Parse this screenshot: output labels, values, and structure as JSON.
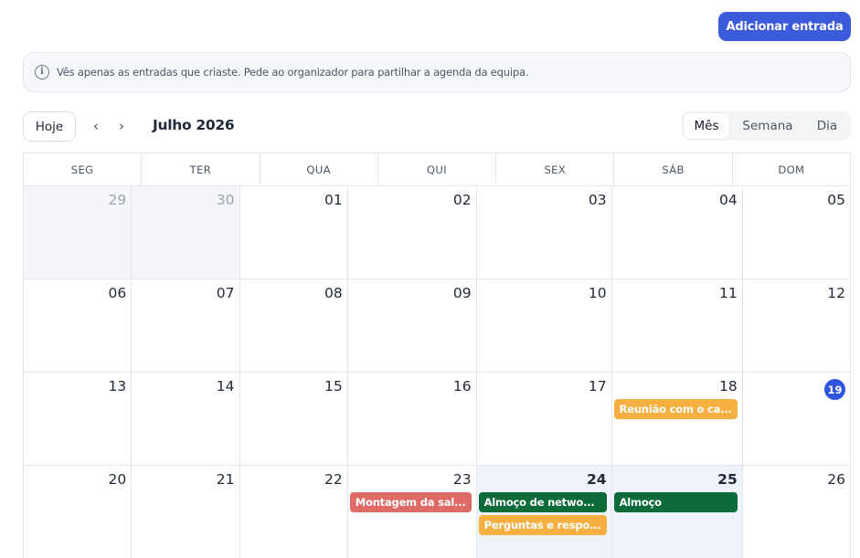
{
  "header": {
    "add_entry_label": "Adicionar entrada"
  },
  "info_banner": {
    "icon": "info-icon",
    "text": "Vês apenas as entradas que criaste. Pede ao organizador para partilhar a agenda da equipa."
  },
  "toolbar": {
    "today_label": "Hoje",
    "prev_icon": "chevron-left-icon",
    "next_icon": "chevron-right-icon",
    "prev_symbol": "‹",
    "next_symbol": "›",
    "month_label": "Julho 2026",
    "views": [
      {
        "label": "Mês",
        "active": true
      },
      {
        "label": "Semana",
        "active": false
      },
      {
        "label": "Dia",
        "active": false
      }
    ]
  },
  "calendar": {
    "weekdays": [
      "SEG",
      "TER",
      "QUA",
      "QUI",
      "SEX",
      "SÁB",
      "DOM"
    ],
    "weeks": [
      [
        {
          "num": "29",
          "outside": true
        },
        {
          "num": "30",
          "outside": true
        },
        {
          "num": "01"
        },
        {
          "num": "02"
        },
        {
          "num": "03"
        },
        {
          "num": "04"
        },
        {
          "num": "05"
        }
      ],
      [
        {
          "num": "06"
        },
        {
          "num": "07"
        },
        {
          "num": "08"
        },
        {
          "num": "09"
        },
        {
          "num": "10"
        },
        {
          "num": "11"
        },
        {
          "num": "12"
        }
      ],
      [
        {
          "num": "13"
        },
        {
          "num": "14"
        },
        {
          "num": "15"
        },
        {
          "num": "16"
        },
        {
          "num": "17"
        },
        {
          "num": "18",
          "events": [
            {
              "title": "Reunião com o ca...",
              "color": "#f5b041"
            }
          ]
        },
        {
          "num": "19",
          "today": true
        }
      ],
      [
        {
          "num": "20"
        },
        {
          "num": "21"
        },
        {
          "num": "22"
        },
        {
          "num": "23",
          "events": [
            {
              "title": "Montagem da sal...",
              "color": "#e06b66"
            }
          ]
        },
        {
          "num": "24",
          "highlight": true,
          "bold": true,
          "events": [
            {
              "title": "Almoço de netwo...",
              "color": "#0d6b3a"
            },
            {
              "title": "Perguntas e respo...",
              "color": "#f5b041"
            }
          ]
        },
        {
          "num": "25",
          "highlight": true,
          "bold": true,
          "events": [
            {
              "title": "Almoço",
              "color": "#0d6b3a"
            }
          ]
        },
        {
          "num": "26"
        }
      ]
    ]
  },
  "colors": {
    "accent": "#3b5bdb",
    "today": "#2f55e0",
    "event_orange": "#f5b041",
    "event_red": "#e06b66",
    "event_green": "#0d6b3a"
  }
}
